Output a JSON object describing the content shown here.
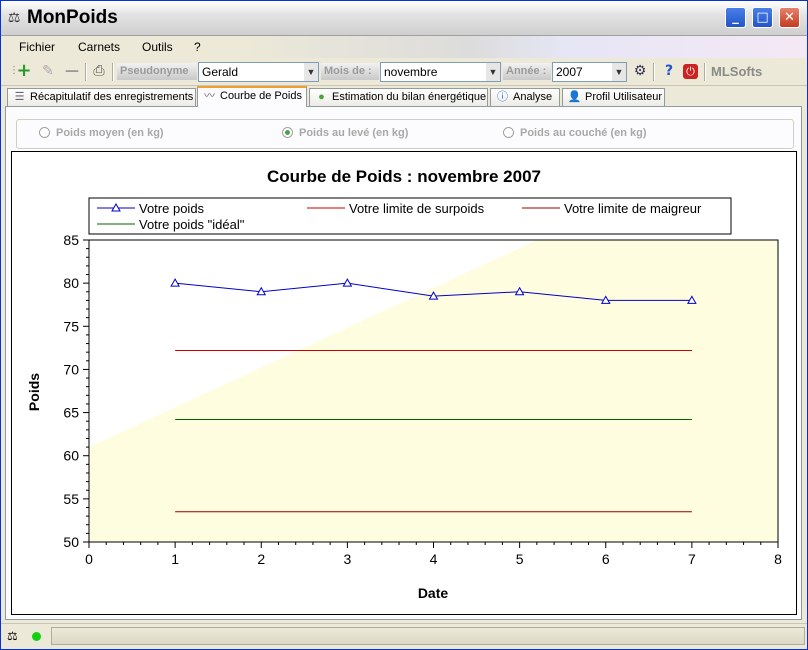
{
  "window": {
    "title": "MonPoids"
  },
  "menu": {
    "items": [
      "Fichier",
      "Carnets",
      "Outils",
      "?"
    ]
  },
  "toolbar": {
    "pseudonyme_label": "Pseudonyme",
    "pseudonyme_value": "Gerald",
    "mois_label": "Mois de :",
    "mois_value": "novembre",
    "annee_label": "Année :",
    "annee_value": "2007",
    "brand": "MLSofts"
  },
  "tabs": [
    {
      "label": "Récapitulatif des enregistrements",
      "active": false
    },
    {
      "label": "Courbe de Poids",
      "active": true
    },
    {
      "label": "Estimation du bilan énergétique",
      "active": false
    },
    {
      "label": "Analyse",
      "active": false
    },
    {
      "label": "Profil Utilisateur",
      "active": false
    }
  ],
  "radios": [
    {
      "label": "Poids moyen (en kg)",
      "selected": false
    },
    {
      "label": "Poids au levé (en kg)",
      "selected": true
    },
    {
      "label": "Poids au couché (en kg)",
      "selected": false
    }
  ],
  "chart_data": {
    "type": "line",
    "title": "Courbe de Poids : novembre 2007",
    "xlabel": "Date",
    "ylabel": "Poids",
    "xlim": [
      0,
      8
    ],
    "ylim": [
      50,
      85
    ],
    "xticks": [
      0,
      1,
      2,
      3,
      4,
      5,
      6,
      7,
      8
    ],
    "yticks": [
      50,
      55,
      60,
      65,
      70,
      75,
      80,
      85
    ],
    "grid": false,
    "legend_position": "top",
    "series": [
      {
        "name": "Votre poids",
        "color": "#0000cc",
        "marker": "triangle",
        "x": [
          1,
          2,
          3,
          4,
          5,
          6,
          7
        ],
        "y": [
          80,
          79,
          80,
          78.5,
          79,
          78,
          78
        ]
      },
      {
        "name": "Votre limite de surpoids",
        "color": "#cc0000",
        "x": [
          1,
          7
        ],
        "y": [
          72.2,
          72.2
        ]
      },
      {
        "name": "Votre limite de maigreur",
        "color": "#990000",
        "x": [
          1,
          7
        ],
        "y": [
          53.5,
          53.5
        ]
      },
      {
        "name": "Votre poids \"idéal\"",
        "color": "#006600",
        "x": [
          1,
          7
        ],
        "y": [
          64.2,
          64.2
        ]
      }
    ],
    "background_region": {
      "color": "#fffde0",
      "boundary_x": [
        0,
        5.2
      ],
      "boundary_y": [
        61,
        85
      ]
    }
  }
}
